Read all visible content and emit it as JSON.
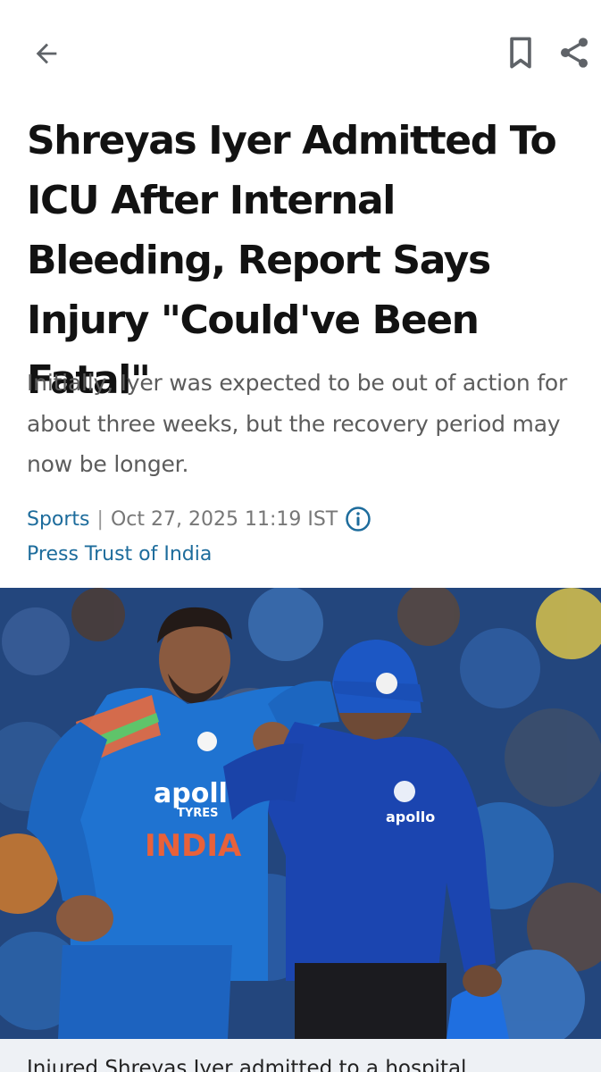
{
  "toolbar": {
    "back_icon": "arrow-left-icon",
    "bookmark_icon": "bookmark-icon",
    "share_icon": "share-icon",
    "icon_color": "#5f6368"
  },
  "article": {
    "headline": "Shreyas Iyer Admitted To ICU After Internal Bleeding, Report Says Injury \"Could've Been Fatal\"",
    "summary": "Initially, Iyer was expected to be out of action for about three weeks, but the recovery period may now be longer.",
    "category": "Sports",
    "separator": "|",
    "timestamp": "Oct 27, 2025 11:19 IST",
    "info_icon": "info-icon",
    "source": "Press Trust of India",
    "link_color": "#1d6c9c",
    "image": {
      "jersey_text_sponsor": "apollo",
      "jersey_text_sponsor_sub": "TYRES",
      "jersey_text_team": "INDIA",
      "caption": "Injured Shreyas Iyer admitted to a hospital"
    }
  }
}
